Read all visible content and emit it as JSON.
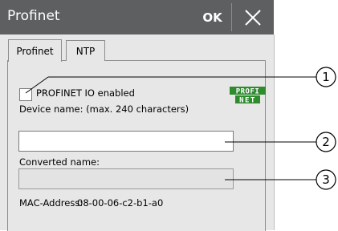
{
  "window": {
    "title": "Profinet",
    "ok_label": "OK"
  },
  "tabs": [
    {
      "label": "Profinet",
      "active": true
    },
    {
      "label": "NTP",
      "active": false
    }
  ],
  "profinet_io": {
    "label": "PROFINET IO enabled",
    "checked": false
  },
  "logo": {
    "line1": "PROFI",
    "line2": "NET"
  },
  "device_name": {
    "label": "Device name: (max. 240 characters)",
    "value": ""
  },
  "converted_name": {
    "label": "Converted name:",
    "value": ""
  },
  "mac": {
    "label": "MAC-Address:",
    "value": "08-00-06-c2-b1-a0"
  },
  "callouts": [
    "1",
    "2",
    "3"
  ],
  "colors": {
    "titlebar": "#5d5f61",
    "panel": "#e7e7e7",
    "logo_green": "#2e8b2e"
  }
}
